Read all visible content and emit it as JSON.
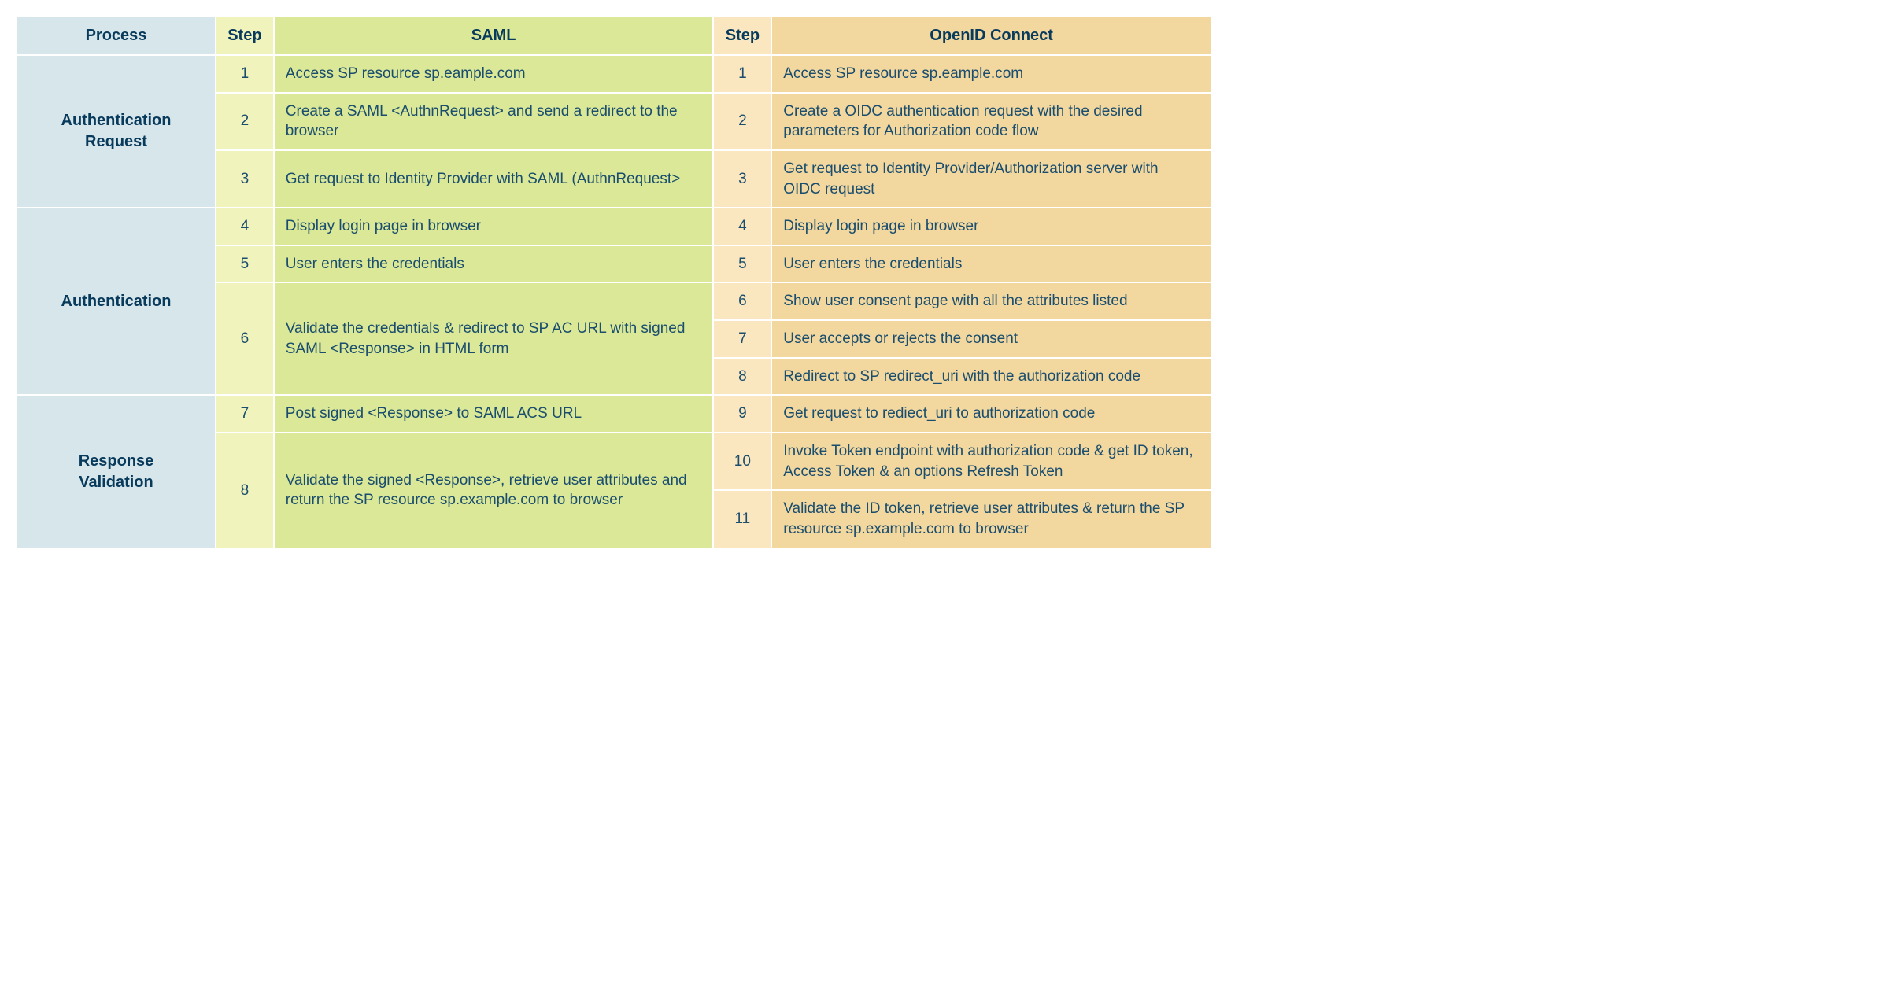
{
  "headers": {
    "process": "Process",
    "step_s": "Step",
    "saml": "SAML",
    "step_o": "Step",
    "oidc": "OpenID Connect"
  },
  "sections": [
    {
      "name": "Authentication Request",
      "saml": [
        {
          "step": "1",
          "text": "Access SP resource sp.eample.com"
        },
        {
          "step": "2",
          "text": "Create a SAML <AuthnRequest> and send a redirect to the browser"
        },
        {
          "step": "3",
          "text": "Get request to Identity Provider with SAML (AuthnRequest>"
        }
      ],
      "oidc": [
        {
          "step": "1",
          "text": "Access SP resource sp.eample.com"
        },
        {
          "step": "2",
          "text": "Create a OIDC authentication request with the desired parameters for Authorization code flow"
        },
        {
          "step": "3",
          "text": "Get request to Identity Provider/Authorization server with OIDC request"
        }
      ]
    },
    {
      "name": "Authentication",
      "saml": [
        {
          "step": "4",
          "text": "Display login page in browser"
        },
        {
          "step": "5",
          "text": "User enters the credentials"
        },
        {
          "step": "6",
          "text": "Validate the credentials & redirect to SP AC URL with signed SAML <Response> in HTML form",
          "span": 3
        }
      ],
      "oidc": [
        {
          "step": "4",
          "text": "Display login page in browser"
        },
        {
          "step": "5",
          "text": "User enters the credentials"
        },
        {
          "step": "6",
          "text": "Show user consent page with all the attributes listed"
        },
        {
          "step": "7",
          "text": "User accepts or rejects the consent"
        },
        {
          "step": "8",
          "text": "Redirect to SP redirect_uri with the authorization code"
        }
      ]
    },
    {
      "name": "Response Validation",
      "saml": [
        {
          "step": "7",
          "text": "Post signed <Response> to SAML ACS URL"
        },
        {
          "step": "8",
          "text": "Validate the signed <Response>, retrieve user attributes and return the SP resource sp.example.com to browser",
          "span": 2
        }
      ],
      "oidc": [
        {
          "step": "9",
          "text": "Get request to rediect_uri to authorization code"
        },
        {
          "step": "10",
          "text": "Invoke Token endpoint with authorization code & get ID token, Access Token & an options Refresh Token"
        },
        {
          "step": "11",
          "text": "Validate the ID token, retrieve user attributes & return the SP resource sp.example.com to browser"
        }
      ]
    }
  ]
}
